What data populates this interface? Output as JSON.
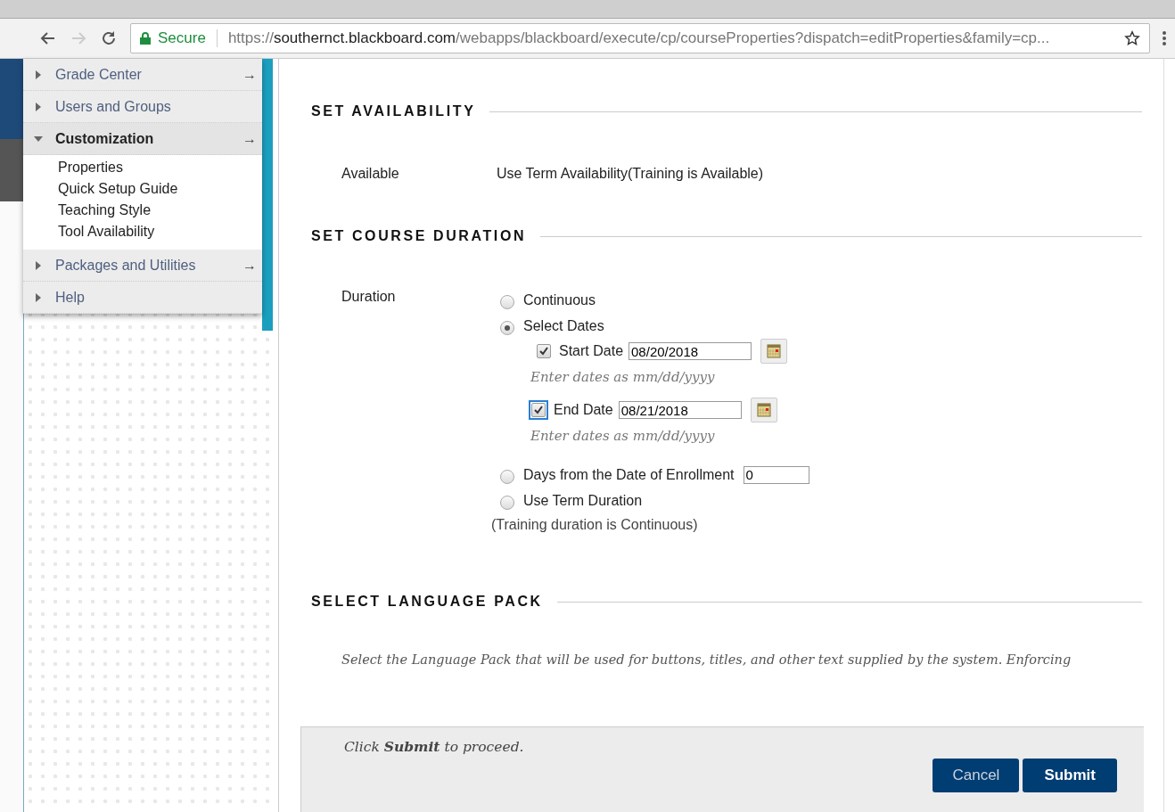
{
  "browser": {
    "secure_label": "Secure",
    "url_scheme": "https://",
    "url_host": "southernct.blackboard.com",
    "url_path": "/webapps/blackboard/execute/cp/courseProperties?dispatch=editProperties&family=cp..."
  },
  "menu": {
    "items": [
      {
        "label": "Grade Center",
        "expanded": false,
        "arrow": "→"
      },
      {
        "label": "Users and Groups",
        "expanded": false
      },
      {
        "label": "Customization",
        "expanded": true,
        "arrow": "→",
        "children": [
          {
            "label": "Properties"
          },
          {
            "label": "Quick Setup Guide"
          },
          {
            "label": "Teaching Style"
          },
          {
            "label": "Tool Availability"
          }
        ]
      },
      {
        "label": "Packages and Utilities",
        "expanded": false,
        "arrow": "→"
      },
      {
        "label": "Help",
        "expanded": false
      }
    ]
  },
  "availability": {
    "heading": "SET AVAILABILITY",
    "label": "Available",
    "value": "Use Term Availability(Training is Available)"
  },
  "duration": {
    "heading": "SET COURSE DURATION",
    "label": "Duration",
    "options": [
      {
        "kind": "plain",
        "label": "Continuous",
        "selected": false
      },
      {
        "kind": "dates",
        "label": "Select Dates",
        "selected": true,
        "dates": [
          {
            "label": "Start Date",
            "checked": true,
            "focused": false,
            "value": "08/20/2018",
            "hint": "Enter dates as mm/dd/yyyy"
          },
          {
            "label": "End Date",
            "checked": true,
            "focused": true,
            "value": "08/21/2018",
            "hint": "Enter dates as mm/dd/yyyy"
          }
        ]
      },
      {
        "kind": "days",
        "label": "Days from the Date of Enrollment",
        "selected": false,
        "value": "0"
      },
      {
        "kind": "plain",
        "label": "Use Term Duration",
        "selected": false
      }
    ],
    "note": "(Training duration is Continuous)"
  },
  "language": {
    "heading": "SELECT LANGUAGE PACK",
    "description": "Select the Language Pack that will be used for buttons, titles, and other text supplied by the system. Enforcing"
  },
  "footer": {
    "instruction": "Click **Submit** to proceed.",
    "buttons": [
      {
        "label": "Cancel",
        "kind": "cancel"
      },
      {
        "label": "Submit",
        "kind": "submit"
      }
    ]
  }
}
